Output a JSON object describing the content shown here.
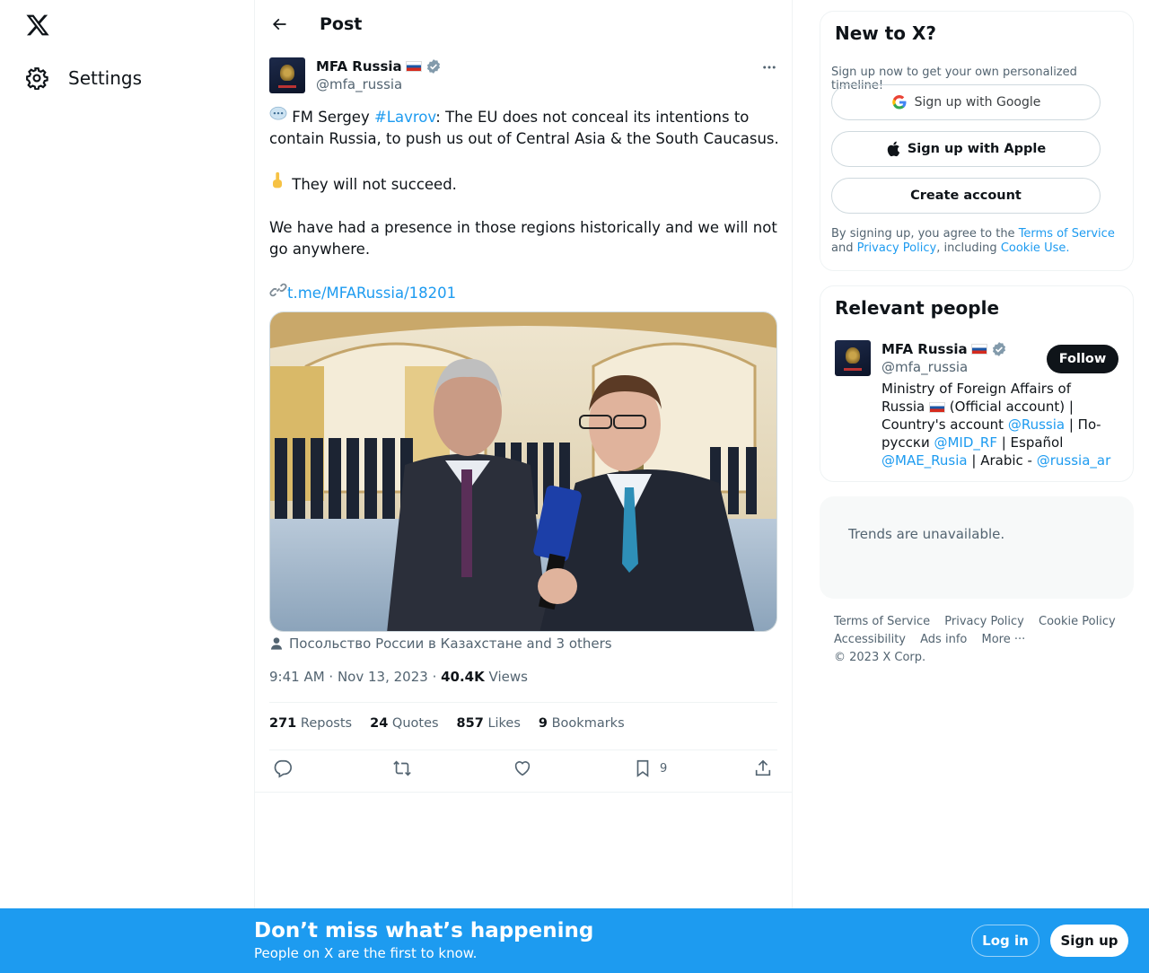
{
  "nav": {
    "settings_label": "Settings",
    "logo_icon": "x-logo-icon"
  },
  "header": {
    "title": "Post"
  },
  "post": {
    "author_name": "MFA Russia",
    "author_handle": "@mfa_russia",
    "text_parts": {
      "p1_pre": " FM Sergey ",
      "p1_hashtag": "#Lavrov",
      "p1_post": ": The EU does not conceal its intentions to contain Russia, to push us out of Central Asia &  the South Caucasus.",
      "p2": " They will not succeed.",
      "p3": "We have had a presence in those regions historically and we will not go anywhere.",
      "link": "t.me/MFARussia/18201"
    },
    "tagged": "Посольство России в Казахстане and 3 others",
    "time": "9:41 AM · Nov 13, 2023 · ",
    "views_count": "40.4K",
    "views_label": "Views",
    "stats": {
      "reposts_count": "271",
      "reposts_label": "Reposts",
      "quotes_count": "24",
      "quotes_label": "Quotes",
      "likes_count": "857",
      "likes_label": "Likes",
      "bookmarks_count": "9",
      "bookmarks_label": "Bookmarks"
    },
    "bookmark_action_count": "9"
  },
  "sidebar": {
    "new_to_x": {
      "title": "New to X?",
      "subtitle": "Sign up now to get your own personalized timeline!",
      "google_label": "Sign up with Google",
      "apple_label": "Sign up with Apple",
      "create_label": "Create account",
      "terms_pre": "By signing up, you agree to the ",
      "terms_link": "Terms of Service",
      "terms_mid": " and ",
      "privacy_link": "Privacy Policy",
      "terms_mid2": ", including ",
      "cookie_link": "Cookie Use."
    },
    "relevant": {
      "title": "Relevant people",
      "name": "MFA Russia",
      "handle": "@mfa_russia",
      "follow_label": "Follow",
      "bio_1": "Ministry of Foreign Affairs of Russia ",
      "bio_2": " (Official account) | Country's account ",
      "bio_m1": "@Russia",
      "bio_3": " | По-русски ",
      "bio_m2": "@MID_RF",
      "bio_4": " | Español ",
      "bio_m3": "@MAE_Rusia",
      "bio_5": " | Arabic - ",
      "bio_m4": "@russia_ar"
    },
    "trends": {
      "text": "Trends are unavailable."
    },
    "footer": [
      "Terms of Service",
      "Privacy Policy",
      "Cookie Policy",
      "Accessibility",
      "Ads info",
      "More ···",
      "© 2023 X Corp."
    ]
  },
  "banner": {
    "headline": "Don’t miss what’s happening",
    "sub": "People on X are the first to know.",
    "login": "Log in",
    "signup": "Sign up"
  },
  "colors": {
    "accent": "#1d9bf0",
    "text": "#0f1419",
    "muted": "#536471"
  }
}
